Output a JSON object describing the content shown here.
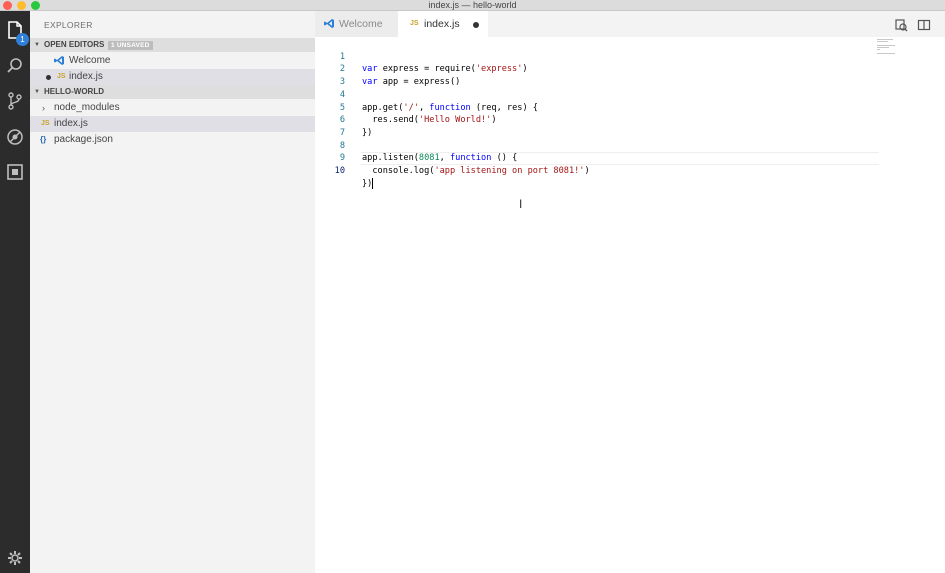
{
  "window": {
    "title": "index.js — hello-world"
  },
  "activity_bar": {
    "icons": [
      "files-icon",
      "search-icon",
      "source-control-icon",
      "debug-icon",
      "extensions-icon",
      "gear-icon"
    ],
    "explorer_badge": "1"
  },
  "sidebar": {
    "title": "EXPLORER",
    "open_editors": {
      "label": "OPEN EDITORS",
      "badge": "1 UNSAVED",
      "items": [
        {
          "label": "Welcome",
          "icon": "vscode-icon"
        },
        {
          "label": "index.js",
          "icon": "js-icon",
          "js": "JS",
          "modified": true
        }
      ]
    },
    "folder": {
      "label": "HELLO-WORLD",
      "items": [
        {
          "label": "node_modules",
          "icon": "chevron-right-icon"
        },
        {
          "label": "index.js",
          "icon": "js-icon",
          "js": "JS"
        },
        {
          "label": "package.json",
          "icon": "json-icon",
          "json": "{}"
        }
      ]
    }
  },
  "tabs": [
    {
      "label": "Welcome",
      "icon": "vscode-icon",
      "active": false
    },
    {
      "label": "index.js",
      "icon": "js-icon",
      "js": "JS",
      "active": true,
      "modified": true
    }
  ],
  "editor": {
    "line_numbers": [
      "1",
      "2",
      "3",
      "4",
      "5",
      "6",
      "7",
      "8",
      "9",
      "10"
    ],
    "code": {
      "l1": {
        "a": "var",
        "b": " express = require(",
        "c": "'express'",
        "d": ")"
      },
      "l2": {
        "a": "var",
        "b": " app = express()"
      },
      "l4": {
        "a": "app.get(",
        "b": "'/'",
        "c": ", ",
        "d": "function",
        "e": " (req, res) {"
      },
      "l5": {
        "a": "  res.send(",
        "b": "'Hello World!'",
        "c": ")"
      },
      "l6": {
        "a": "})"
      },
      "l8": {
        "a": "app.listen(",
        "b": "8081",
        "c": ", ",
        "d": "function",
        "e": " () {"
      },
      "l9": {
        "a": "  console.log(",
        "b": "'app listening on port 8081!'",
        "c": ")"
      },
      "l10": {
        "a": "})"
      }
    }
  },
  "colors": {
    "activity_bar": "#2c2c2c",
    "sidebar": "#f3f3f3",
    "keyword": "#0000ff",
    "string": "#a31515",
    "number": "#098658",
    "line_number": "#237893"
  }
}
